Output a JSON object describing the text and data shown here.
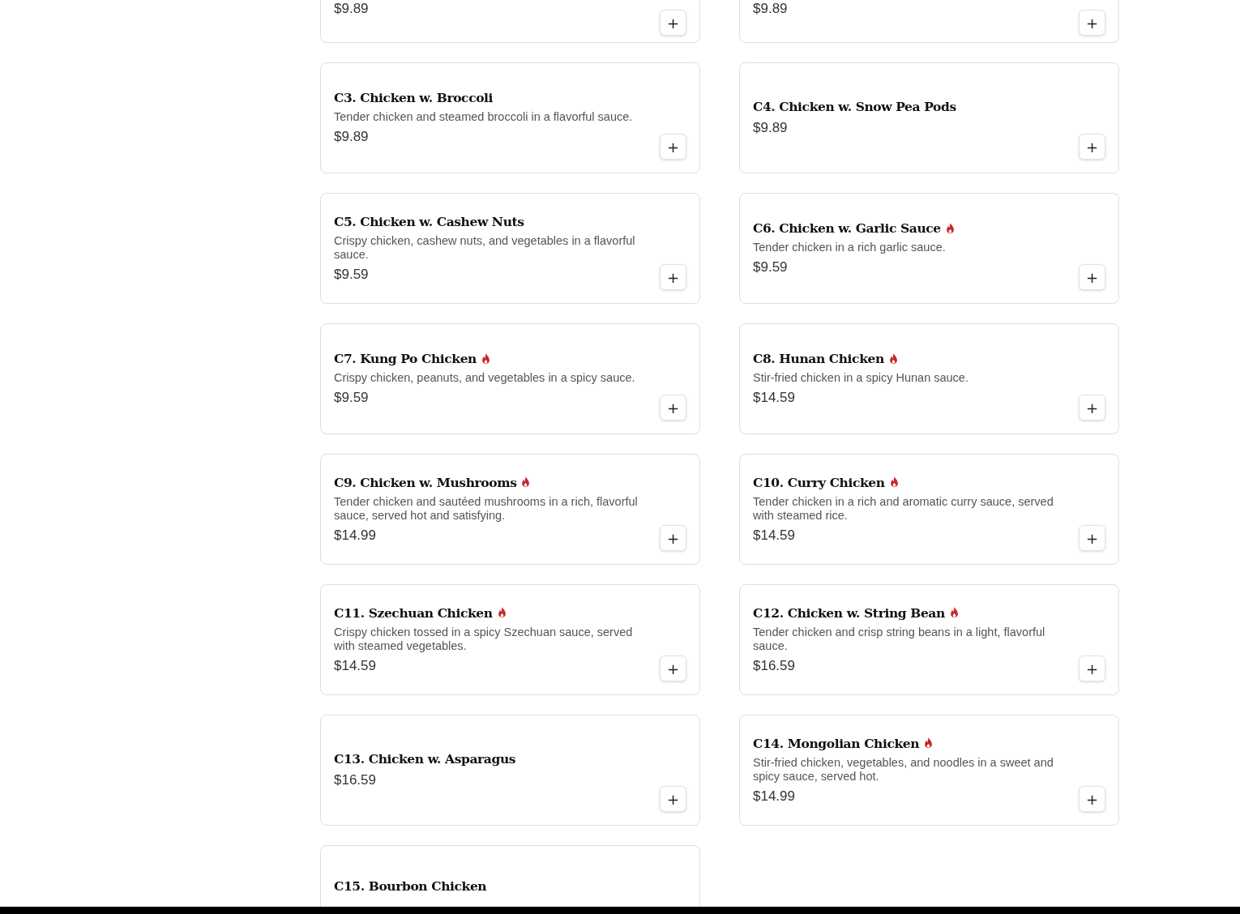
{
  "rows": [
    {
      "items": [
        {
          "kind": "cut_top",
          "price": "$9.89",
          "button": "+"
        },
        {
          "kind": "cut_top",
          "price": "$9.89",
          "button": "+"
        }
      ]
    },
    {
      "items": [
        {
          "kind": "full",
          "name": "C3. Chicken w. Broccoli",
          "spicy": false,
          "description": "Tender chicken and steamed broccoli in a flavorful sauce.",
          "price": "$9.89",
          "button": "+"
        },
        {
          "kind": "full",
          "name": "C4. Chicken w. Snow Pea Pods",
          "spicy": false,
          "price": "$9.89",
          "button": "+"
        }
      ]
    },
    {
      "items": [
        {
          "kind": "full",
          "name": "C5. Chicken w. Cashew Nuts",
          "spicy": false,
          "description": "Crispy chicken, cashew nuts, and vegetables in a flavorful sauce.",
          "price": "$9.59",
          "button": "+"
        },
        {
          "kind": "full",
          "name": "C6. Chicken w. Garlic Sauce",
          "spicy": true,
          "description": "Tender chicken in a rich garlic sauce.",
          "price": "$9.59",
          "button": "+"
        }
      ]
    },
    {
      "items": [
        {
          "kind": "full",
          "name": "C7. Kung Po Chicken",
          "spicy": true,
          "description": "Crispy chicken, peanuts, and vegetables in a spicy sauce.",
          "price": "$9.59",
          "button": "+"
        },
        {
          "kind": "full",
          "name": "C8. Hunan Chicken",
          "spicy": true,
          "description": "Stir-fried chicken in a spicy Hunan sauce.",
          "price": "$14.59",
          "button": "+"
        }
      ]
    },
    {
      "items": [
        {
          "kind": "full",
          "name": "C9. Chicken w. Mushrooms",
          "spicy": true,
          "description": "Tender chicken and sautéed mushrooms in a rich, flavorful sauce, served hot and satisfying.",
          "price": "$14.99",
          "button": "+"
        },
        {
          "kind": "full",
          "name": "C10. Curry Chicken",
          "spicy": true,
          "description": "Tender chicken in a rich and aromatic curry sauce, served with steamed rice.",
          "price": "$14.59",
          "button": "+"
        }
      ]
    },
    {
      "items": [
        {
          "kind": "full",
          "name": "C11. Szechuan Chicken",
          "spicy": true,
          "description": "Crispy chicken tossed in a spicy Szechuan sauce, served with steamed vegetables.",
          "price": "$14.59",
          "button": "+"
        },
        {
          "kind": "full",
          "name": "C12. Chicken w. String Bean",
          "spicy": true,
          "description": "Tender chicken and crisp string beans in a light, flavorful sauce.",
          "price": "$16.59",
          "button": "+"
        }
      ]
    },
    {
      "items": [
        {
          "kind": "full",
          "name": "C13. Chicken w. Asparagus",
          "spicy": false,
          "price": "$16.59",
          "button": "+"
        },
        {
          "kind": "full",
          "name": "C14. Mongolian Chicken",
          "spicy": true,
          "description": "Stir-fried chicken, vegetables, and noodles in a sweet and spicy sauce, served hot.",
          "price": "$14.99",
          "button": "+"
        }
      ]
    },
    {
      "items": [
        {
          "kind": "cut_bottom",
          "name": "C15. Bourbon Chicken",
          "spicy": false
        }
      ]
    }
  ]
}
